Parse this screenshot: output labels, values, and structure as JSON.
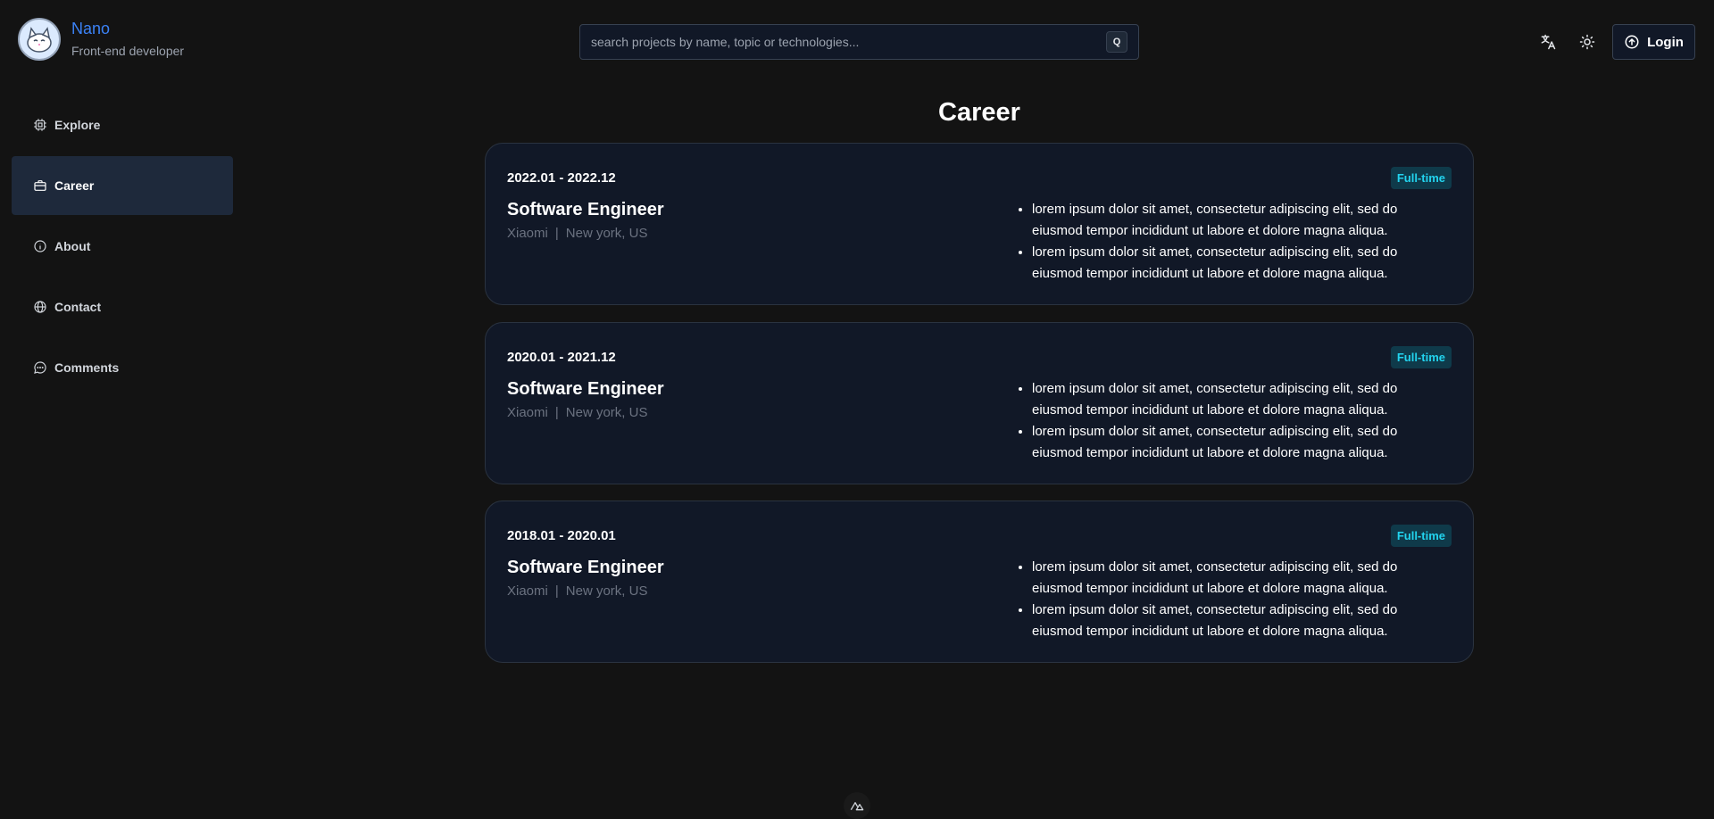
{
  "profile": {
    "name": "Nano",
    "role": "Front-end developer"
  },
  "search": {
    "placeholder": "search projects by name, topic or technologies...",
    "shortcut": "Q"
  },
  "header": {
    "login_label": "Login"
  },
  "sidebar": {
    "items": [
      {
        "label": "Explore",
        "icon": "chip-icon"
      },
      {
        "label": "Career",
        "icon": "briefcase-icon"
      },
      {
        "label": "About",
        "icon": "info-icon"
      },
      {
        "label": "Contact",
        "icon": "globe-icon"
      },
      {
        "label": "Comments",
        "icon": "chat-icon"
      }
    ]
  },
  "main": {
    "title": "Career",
    "cards": [
      {
        "date": "2022.01 - 2022.12",
        "title": "Software Engineer",
        "company": "Xiaomi",
        "separator": "|",
        "location": "New york, US",
        "badge": "Full-time",
        "bullets": [
          "lorem ipsum dolor sit amet, consectetur adipiscing elit, sed do eiusmod tempor incididunt ut labore et dolore magna aliqua.",
          "lorem ipsum dolor sit amet, consectetur adipiscing elit, sed do eiusmod tempor incididunt ut labore et dolore magna aliqua."
        ]
      },
      {
        "date": "2020.01 - 2021.12",
        "title": "Software Engineer",
        "company": "Xiaomi",
        "separator": "|",
        "location": "New york, US",
        "badge": "Full-time",
        "bullets": [
          "lorem ipsum dolor sit amet, consectetur adipiscing elit, sed do eiusmod tempor incididunt ut labore et dolore magna aliqua.",
          "lorem ipsum dolor sit amet, consectetur adipiscing elit, sed do eiusmod tempor incididunt ut labore et dolore magna aliqua."
        ]
      },
      {
        "date": "2018.01 - 2020.01",
        "title": "Software Engineer",
        "company": "Xiaomi",
        "separator": "|",
        "location": "New york, US",
        "badge": "Full-time",
        "bullets": [
          "lorem ipsum dolor sit amet, consectetur adipiscing elit, sed do eiusmod tempor incididunt ut labore et dolore magna aliqua.",
          "lorem ipsum dolor sit amet, consectetur adipiscing elit, sed do eiusmod tempor incididunt ut labore et dolore magna aliqua."
        ]
      }
    ]
  },
  "colors": {
    "background": "#131313",
    "card": "#111827",
    "accent": "#3b82f6",
    "badge_text": "#22d3ee"
  }
}
